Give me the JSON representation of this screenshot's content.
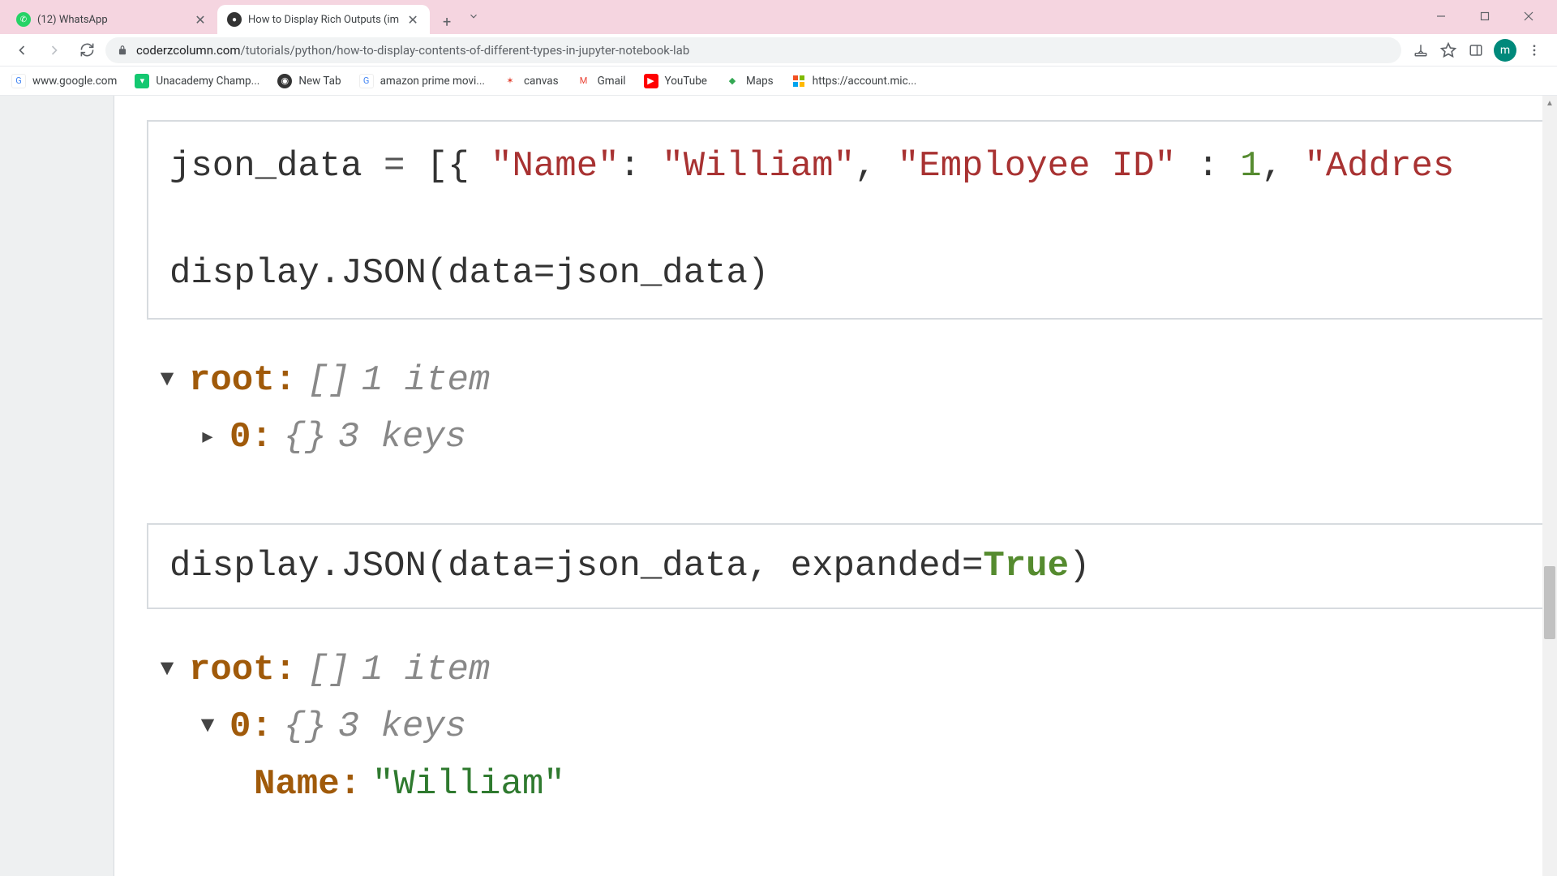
{
  "tabs": [
    {
      "title": "(12) WhatsApp",
      "favicon_bg": "#25d366",
      "favicon_text": "✆",
      "active": false
    },
    {
      "title": "How to Display Rich Outputs (im",
      "favicon_bg": "#333",
      "favicon_text": "●",
      "active": true
    }
  ],
  "url": {
    "host": "coderzcolumn.com",
    "path": "/tutorials/python/how-to-display-contents-of-different-types-in-jupyter-notebook-lab"
  },
  "avatar_letter": "m",
  "bookmarks": [
    {
      "label": "www.google.com",
      "icon_bg": "#fff",
      "icon_text": "G"
    },
    {
      "label": "Unacademy Champ...",
      "icon_bg": "#14c871",
      "icon_text": "▾"
    },
    {
      "label": "New Tab",
      "icon_bg": "#333",
      "icon_text": "◉"
    },
    {
      "label": "amazon prime movi...",
      "icon_bg": "#fff",
      "icon_text": "G"
    },
    {
      "label": "canvas",
      "icon_bg": "#e03e2d",
      "icon_text": "✶"
    },
    {
      "label": "Gmail",
      "icon_bg": "#fff",
      "icon_text": "M"
    },
    {
      "label": "YouTube",
      "icon_bg": "#ff0000",
      "icon_text": "▶"
    },
    {
      "label": "Maps",
      "icon_bg": "#fff",
      "icon_text": "◆"
    },
    {
      "label": "https://account.mic...",
      "icon_bg": "#fff",
      "icon_text": "⊞"
    }
  ],
  "code1": {
    "var": "json_data",
    "key1": "\"Name\"",
    "val1": "\"William\"",
    "key2": "\"Employee ID\"",
    "val2_num": "1",
    "key3_partial": "\"Addres",
    "line2": "display.JSON(data=json_data)"
  },
  "output1": {
    "root_label": "root:",
    "root_brace": "[]",
    "root_meta": "1 item",
    "child_key": "0:",
    "child_brace": "{}",
    "child_meta": "3 keys"
  },
  "code2": {
    "prefix": "display.JSON(data=json_data, expanded=",
    "kwd": "True",
    "suffix": ")"
  },
  "output2": {
    "root_label": "root:",
    "root_brace": "[]",
    "root_meta": "1 item",
    "child_key": "0:",
    "child_brace": "{}",
    "child_meta": "3 keys",
    "leaf_key": "Name:",
    "leaf_val": "\"William\""
  }
}
